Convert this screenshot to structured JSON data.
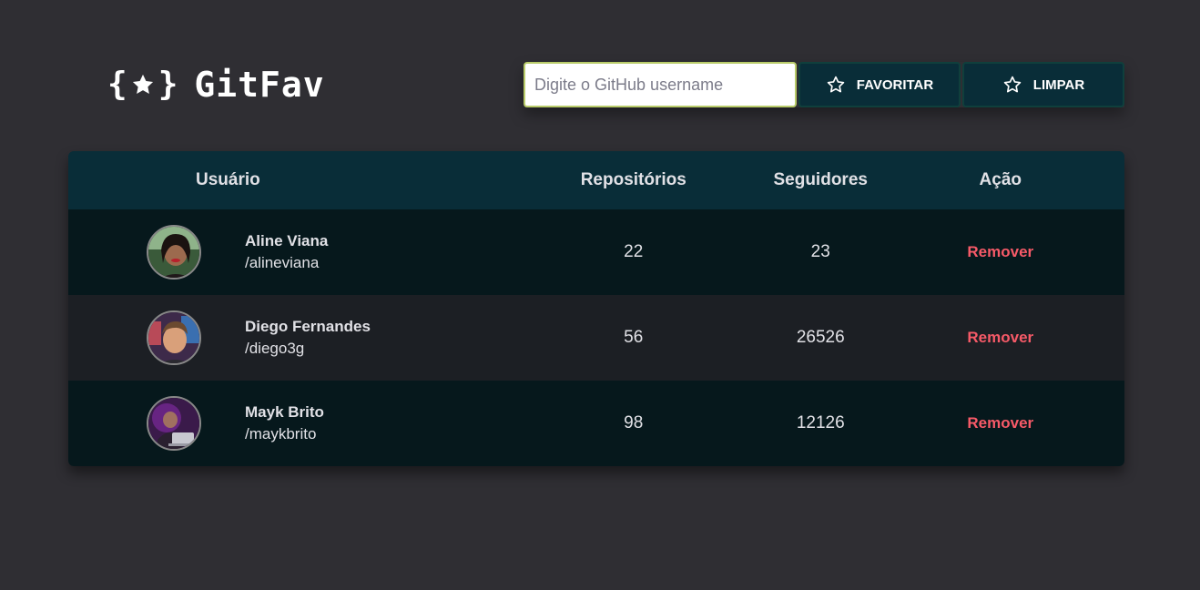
{
  "app": {
    "logo_open_brace": "{",
    "logo_close_brace": "}",
    "title": "GitFav"
  },
  "search": {
    "placeholder": "Digite o GitHub username",
    "value": ""
  },
  "buttons": {
    "favorite_label": "FAVORITAR",
    "clear_label": "LIMPAR"
  },
  "table": {
    "headers": {
      "user": "Usuário",
      "repos": "Repositórios",
      "followers": "Seguidores",
      "action": "Ação"
    },
    "rows": [
      {
        "name": "Aline Viana",
        "login": "/alineviana",
        "repos": "22",
        "followers": "23",
        "action": "Remover"
      },
      {
        "name": "Diego Fernandes",
        "login": "/diego3g",
        "repos": "56",
        "followers": "26526",
        "action": "Remover"
      },
      {
        "name": "Mayk Brito",
        "login": "/maykbrito",
        "repos": "98",
        "followers": "12126",
        "action": "Remover"
      }
    ]
  },
  "colors": {
    "background": "#2f2e33",
    "header_bg": "#092d38",
    "row_odd": "#06181c",
    "row_even": "#1c1f24",
    "remove": "#f75a68",
    "input_border": "#b9cc6a"
  },
  "icons": {
    "logo": "star-in-braces-icon",
    "favorite": "star-outline-icon",
    "clear": "star-outline-icon"
  }
}
